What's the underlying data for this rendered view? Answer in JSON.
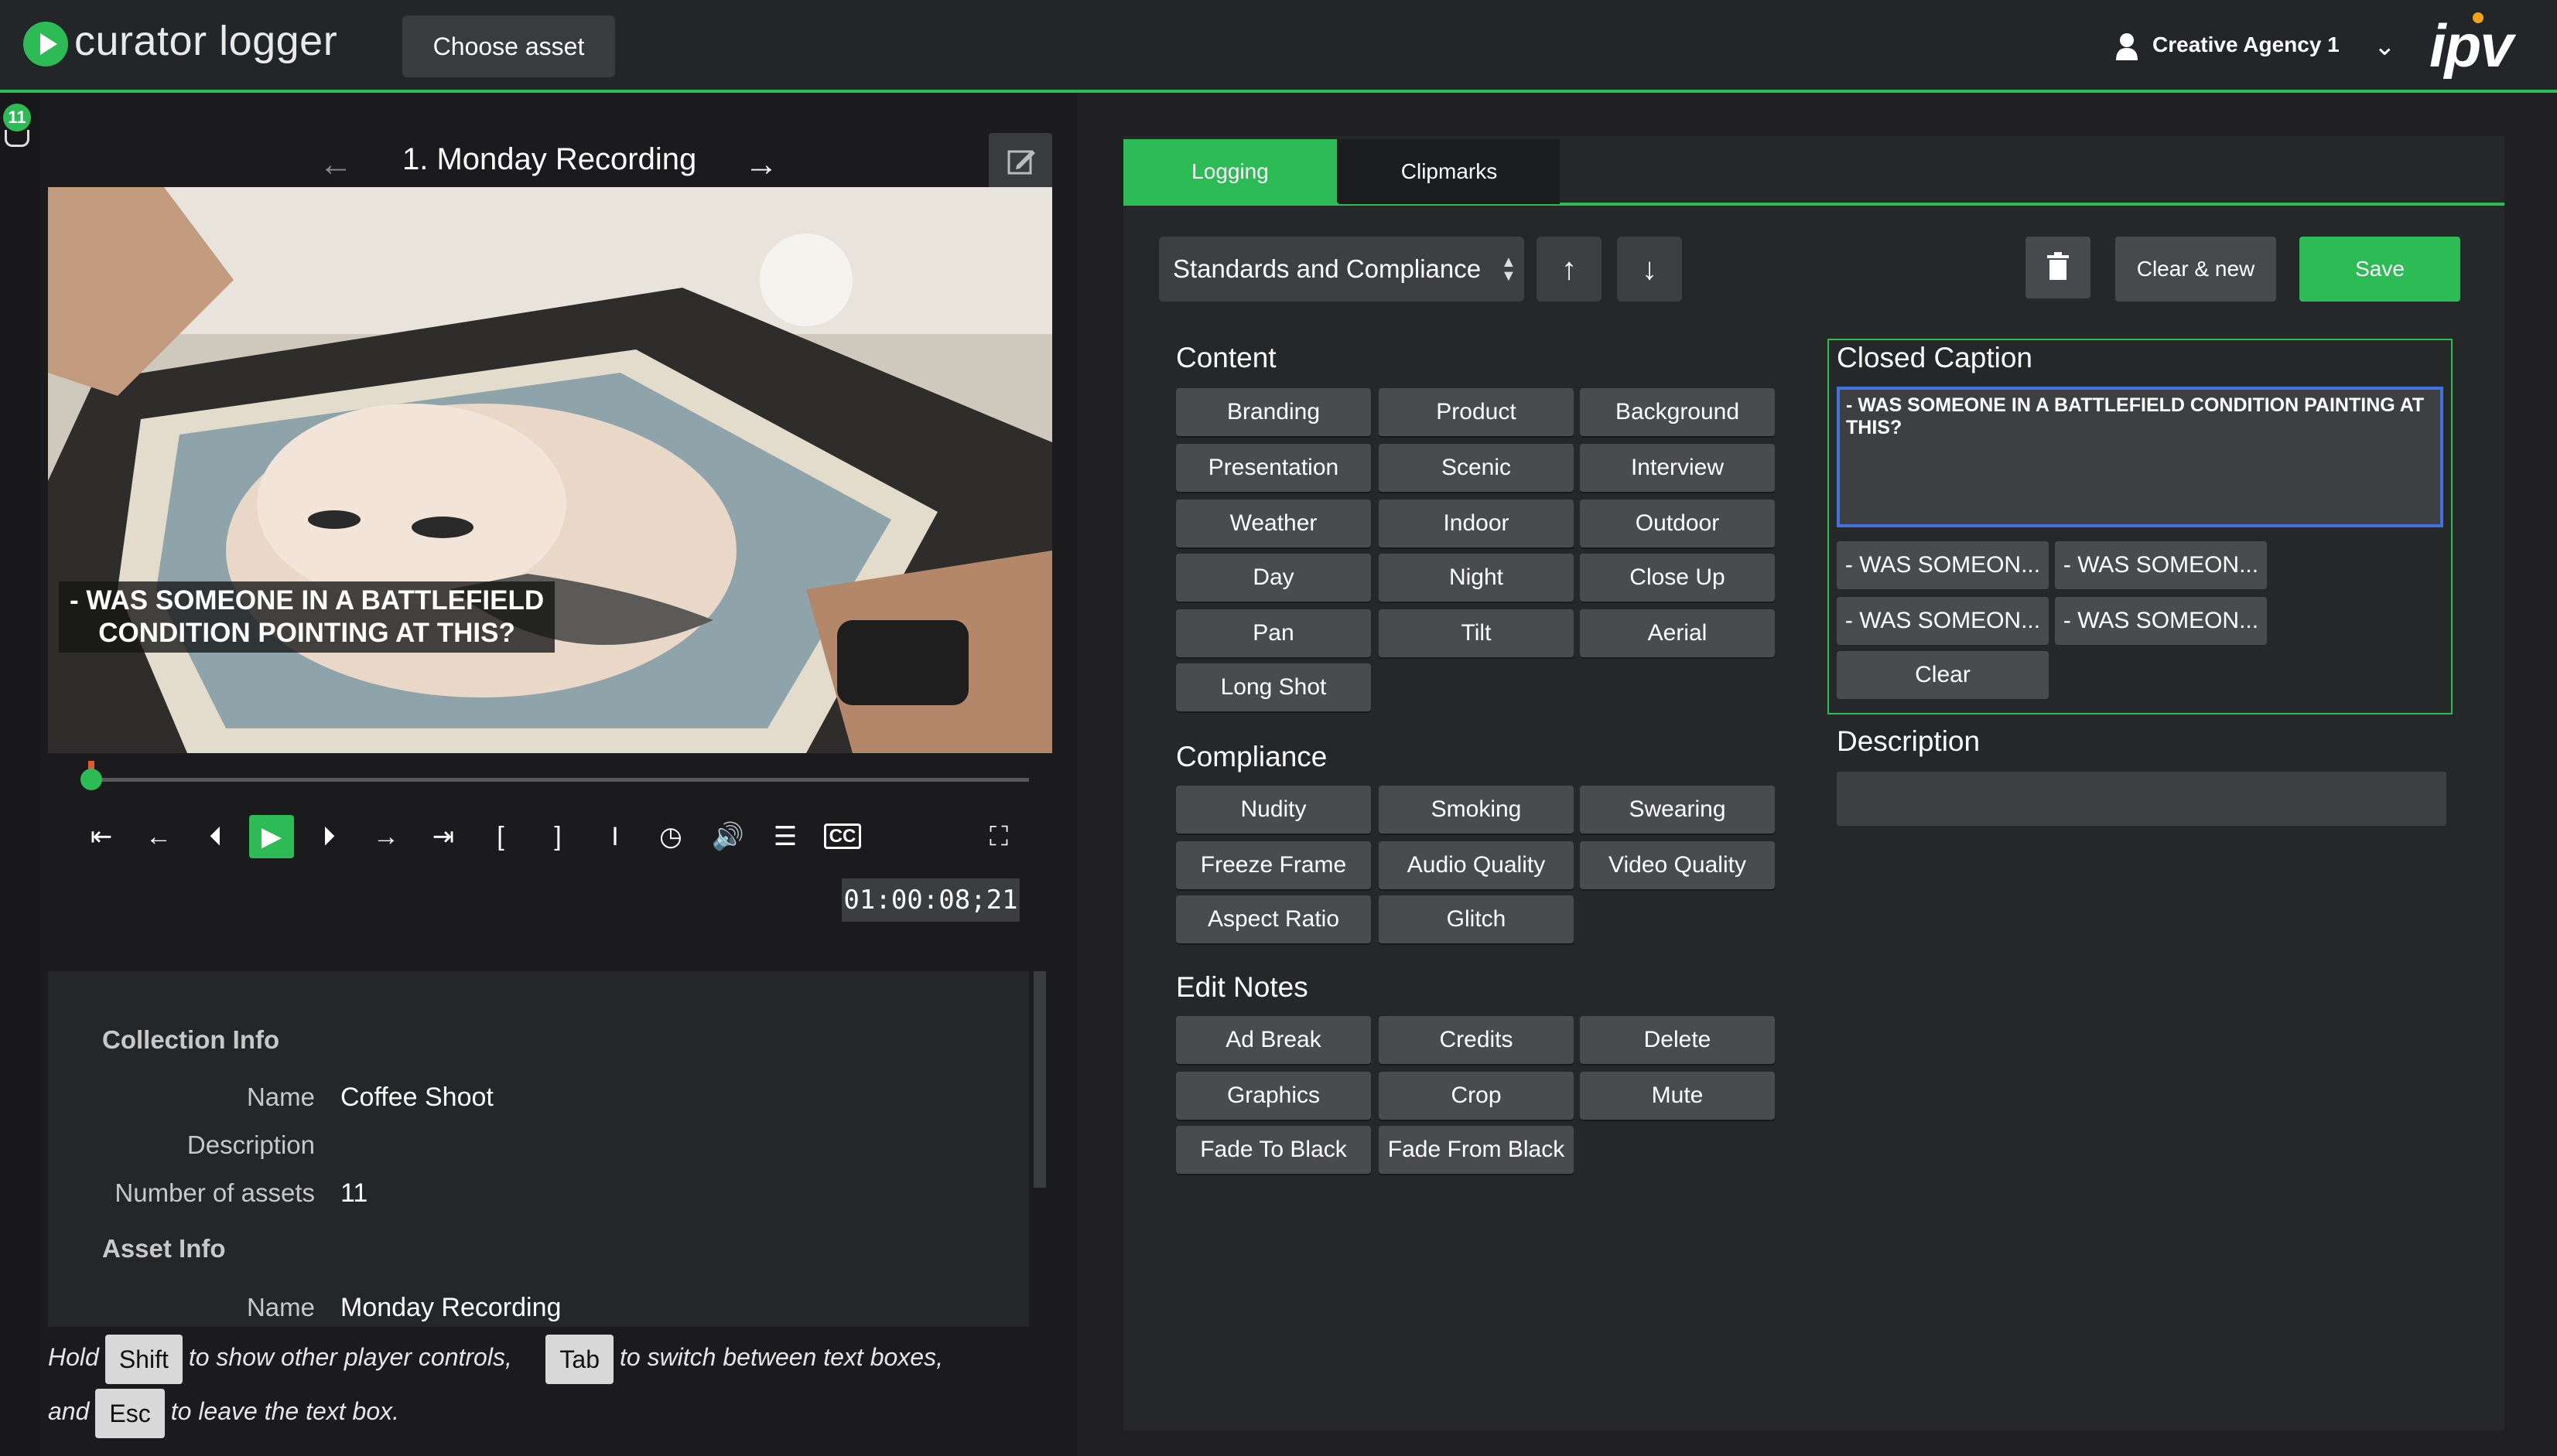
{
  "app": {
    "title": "curator logger",
    "choose_asset": "Choose asset"
  },
  "user": {
    "name": "Creative Agency 1",
    "brand": "ipv"
  },
  "sidebar": {
    "count": "11"
  },
  "player": {
    "asset_title": "1.  Monday Recording",
    "subtitle_line1": "- WAS SOMEONE IN A BATTLEFIELD",
    "subtitle_line2": "CONDITION POINTING AT THIS?",
    "timecode": "01:00:08;21",
    "controls": [
      "go-to-in",
      "step-back",
      "frame-back",
      "play",
      "frame-forward",
      "step-forward",
      "go-to-out",
      "mark-in",
      "mark-out",
      "mark-point",
      "clock",
      "volume",
      "settings",
      "closed-captions",
      "fullscreen"
    ],
    "cc_label": "CC"
  },
  "info": {
    "collection_head": "Collection Info",
    "collection": {
      "name_key": "Name",
      "name": "Coffee Shoot",
      "desc_key": "Description",
      "desc": "",
      "count_key": "Number of assets",
      "count": "11"
    },
    "asset_head": "Asset Info",
    "asset": {
      "name_key": "Name",
      "name": "Monday Recording"
    }
  },
  "hint": {
    "hold": "Hold",
    "shift": "Shift",
    "show": "to show other player controls,",
    "tab": "Tab",
    "switch": "to switch between text boxes,",
    "and": "and",
    "esc": "Esc",
    "leave": "to leave the text box."
  },
  "tabs": {
    "logging": "Logging",
    "clipmarks": "Clipmarks"
  },
  "toolbar": {
    "preset": "Standards and Compliance",
    "clear_new": "Clear & new",
    "save": "Save"
  },
  "content": {
    "title": "Content",
    "buttons": [
      "Branding",
      "Product",
      "Background",
      "Presentation",
      "Scenic",
      "Interview",
      "Weather",
      "Indoor",
      "Outdoor",
      "Day",
      "Night",
      "Close Up",
      "Pan",
      "Tilt",
      "Aerial",
      "Long Shot"
    ]
  },
  "compliance": {
    "title": "Compliance",
    "buttons": [
      "Nudity",
      "Smoking",
      "Swearing",
      "Freeze Frame",
      "Audio Quality",
      "Video Quality",
      "Aspect Ratio",
      "Glitch"
    ]
  },
  "edit_notes": {
    "title": "Edit Notes",
    "buttons": [
      "Ad Break",
      "Credits",
      "Delete",
      "Graphics",
      "Crop",
      "Mute",
      "Fade To Black",
      "Fade From Black"
    ]
  },
  "closed_caption": {
    "title": "Closed Caption",
    "text": "- WAS SOMEONE IN A BATTLEFIELD CONDITION PAINTING AT THIS?",
    "suggestions": [
      "- WAS SOMEON...",
      "- WAS SOMEON...",
      "- WAS SOMEON...",
      "- WAS SOMEON..."
    ],
    "clear": "Clear"
  },
  "description": {
    "title": "Description",
    "value": ""
  },
  "colors": {
    "accent": "#2dbb55",
    "panel": "#262729",
    "button": "#4a4b4f",
    "focus": "#3f73e0"
  }
}
